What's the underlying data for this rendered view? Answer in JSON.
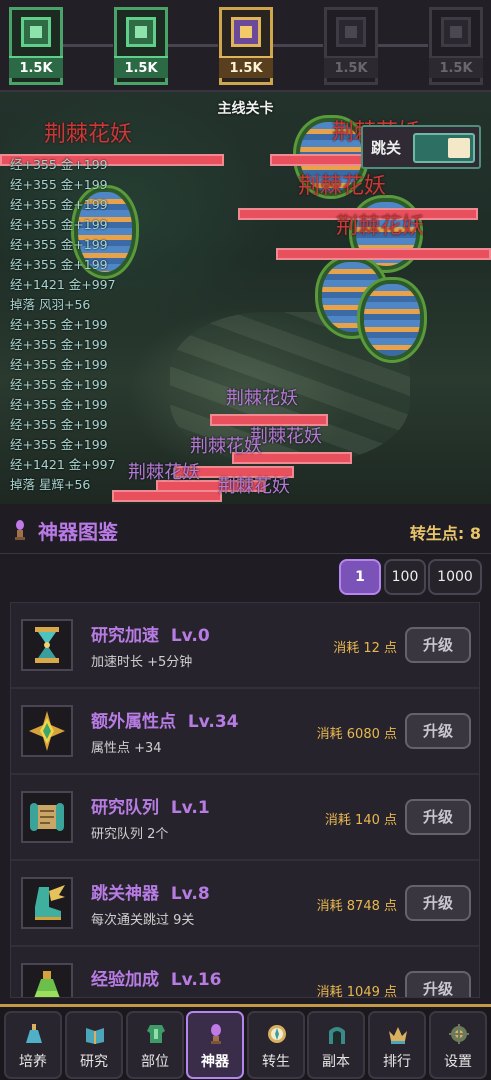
{
  "stages": [
    {
      "value": "1.5K",
      "state": "cleared"
    },
    {
      "value": "1.5K",
      "state": "cleared"
    },
    {
      "value": "1.5K",
      "state": "current"
    },
    {
      "value": "1.5K",
      "state": "locked"
    },
    {
      "value": "1.5K",
      "state": "locked"
    }
  ],
  "scene": {
    "title": "主线关卡",
    "skip_label": "跳关",
    "skip_on": true,
    "monster_name": "荆棘花妖",
    "log": [
      "经+355 金+199",
      "经+355 金+199",
      "经+355 金+199",
      "经+355 金+199",
      "经+355 金+199",
      "经+355 金+199",
      "经+1421 金+997",
      "掉落 风羽+56",
      "经+355 金+199",
      "经+355 金+199",
      "经+355 金+199",
      "经+355 金+199",
      "经+355 金+199",
      "经+355 金+199",
      "经+355 金+199",
      "经+1421 金+997",
      "掉落 星辉+56"
    ]
  },
  "panel": {
    "title": "神器图鉴",
    "points": "转生点: 8",
    "multipliers": [
      "1",
      "100",
      "1000"
    ],
    "selected_multiplier": "1",
    "items": [
      {
        "name": "研究加速",
        "level": "Lv.0",
        "desc": "加速时长 +5分钟",
        "cost": "消耗 12 点",
        "button": "升级",
        "icon": "hourglass-icon"
      },
      {
        "name": "额外属性点",
        "level": "Lv.34",
        "desc": "属性点 +34",
        "cost": "消耗 6080 点",
        "button": "升级",
        "icon": "gem-star-icon"
      },
      {
        "name": "研究队列",
        "level": "Lv.1",
        "desc": "研究队列 2个",
        "cost": "消耗 140 点",
        "button": "升级",
        "icon": "scroll-icon"
      },
      {
        "name": "跳关神器",
        "level": "Lv.8",
        "desc": "每次通关跳过 9关",
        "cost": "消耗 8748 点",
        "button": "升级",
        "icon": "winged-boot-icon"
      },
      {
        "name": "经验加成",
        "level": "Lv.16",
        "desc": "",
        "cost": "消耗 1049 点",
        "button": "升级",
        "icon": "potion-icon"
      }
    ]
  },
  "nav": [
    {
      "label": "培养",
      "icon": "flask-icon"
    },
    {
      "label": "研究",
      "icon": "book-icon"
    },
    {
      "label": "部位",
      "icon": "armor-icon"
    },
    {
      "label": "神器",
      "icon": "artifact-icon",
      "active": true
    },
    {
      "label": "转生",
      "icon": "compass-icon"
    },
    {
      "label": "副本",
      "icon": "gate-icon"
    },
    {
      "label": "排行",
      "icon": "crown-icon"
    },
    {
      "label": "设置",
      "icon": "gear-icon"
    }
  ],
  "colors": {
    "accent": "#b97ae6",
    "gold": "#e9c46a",
    "hp": "#e8505e",
    "cleared": "#4aa46a",
    "current": "#d0a64c"
  }
}
